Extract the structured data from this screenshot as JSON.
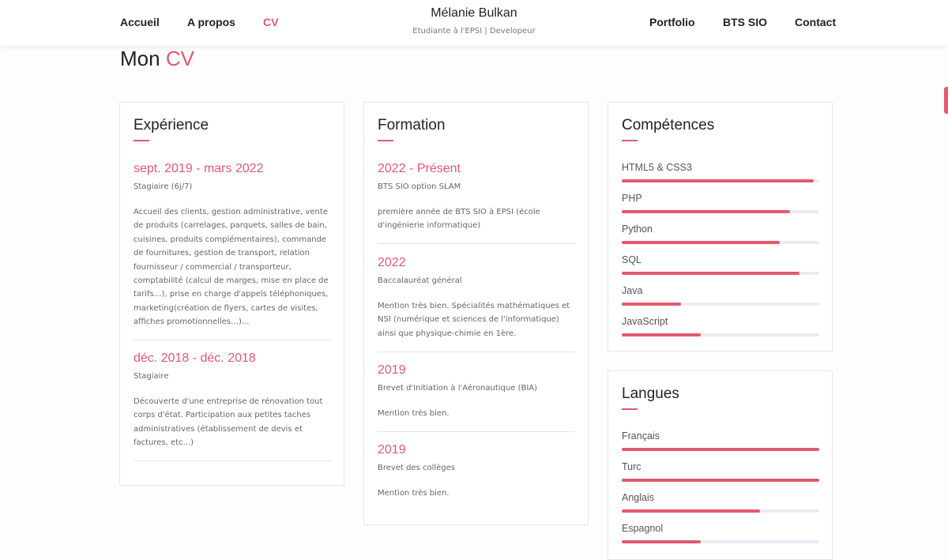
{
  "nav": {
    "left": [
      "Accueil",
      "A propos",
      "CV"
    ],
    "right": [
      "Portfolio",
      "BTS SIO",
      "Contact"
    ],
    "active": "CV"
  },
  "brand": {
    "name": "Mélanie Bulkan",
    "subtitle": "Etudiante à l'EPSI | Developeur"
  },
  "page_title": {
    "prefix": "Mon",
    "accent": "CV"
  },
  "experience": {
    "title": "Expérience",
    "entries": [
      {
        "date": "sept. 2019 - mars 2022",
        "role": "Stagiaire (6j/7)",
        "description": "Accueil des clients, gestion administrative, vente de produits (carrelages, parquets, salles de bain, cuisines, produits complémentaires), commande de fournitures, gestion de transport, relation fournisseur / commercial / transporteur, comptabilité (calcul de marges, mise en place de tarifs…), prise en charge d'appels téléphoniques, marketing(création de flyers, cartes de visites, affiches promotionnelles…)..."
      },
      {
        "date": "déc. 2018 - déc. 2018",
        "role": "Stagiaire",
        "description": "Découverte d'une entreprise de rénovation tout corps d'état. Participation aux petites taches administratives (établissement de devis et factures, etc...)"
      }
    ]
  },
  "formation": {
    "title": "Formation",
    "entries": [
      {
        "date": "2022 - Présent",
        "role": "BTS SIO option SLAM",
        "description": "première année de BTS SIO à EPSI (école d'ingénierie informatique)"
      },
      {
        "date": "2022",
        "role": "Baccalauréat général",
        "description": "Mention très bien. Spécialités mathématiques et NSI (numérique et sciences de l'informatique) ainsi que physique-chimie en 1ère."
      },
      {
        "date": "2019",
        "role": "Brevet d'Initiation à l'Aéronautique (BIA)",
        "description": "Mention très bien."
      },
      {
        "date": "2019",
        "role": "Brevet des collèges",
        "description": "Mention très bien."
      }
    ]
  },
  "skills": {
    "title": "Compétences",
    "items": [
      {
        "name": "HTML5 & CSS3",
        "level": 0.97
      },
      {
        "name": "PHP",
        "level": 0.85
      },
      {
        "name": "Python",
        "level": 0.8
      },
      {
        "name": "SQL",
        "level": 0.9
      },
      {
        "name": "Java",
        "level": 0.3
      },
      {
        "name": "JavaScript",
        "level": 0.4
      }
    ]
  },
  "languages": {
    "title": "Langues",
    "items": [
      {
        "name": "Français",
        "level": 1.0
      },
      {
        "name": "Turc",
        "level": 1.0
      },
      {
        "name": "Anglais",
        "level": 0.7
      },
      {
        "name": "Espagnol",
        "level": 0.4
      }
    ]
  },
  "colors": {
    "accent": "#e2596f",
    "track": "#eaecf4",
    "text": "#222222",
    "muted": "#666666"
  }
}
